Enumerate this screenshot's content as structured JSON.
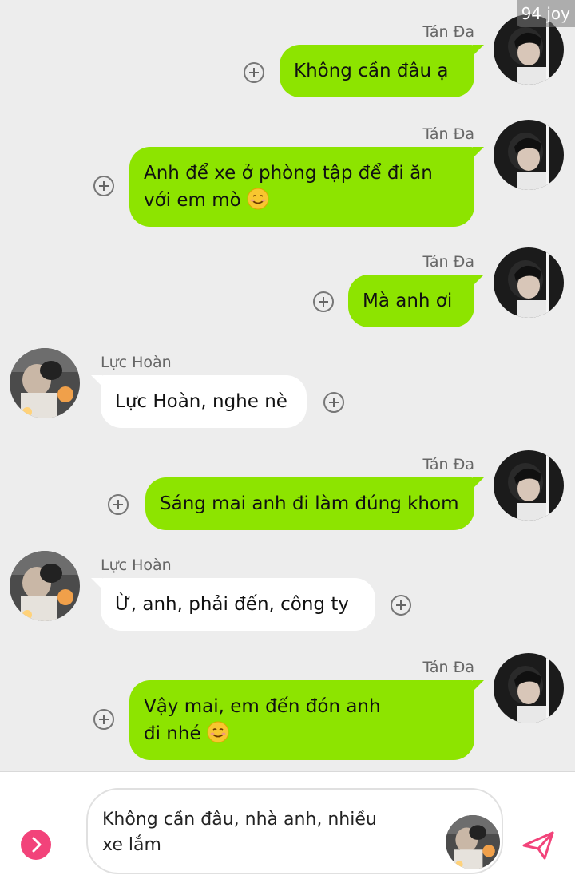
{
  "watermark": "94 joy",
  "messages": [
    {
      "side": "right",
      "sender": "Tán Đa",
      "lines": [
        "Không cần đâu ạ"
      ],
      "emoji": false
    },
    {
      "side": "right",
      "sender": "Tán Đa",
      "lines": [
        "Anh để xe ở phòng tập để đi ăn",
        "với em mò"
      ],
      "emoji": true
    },
    {
      "side": "right",
      "sender": "Tán Đa",
      "lines": [
        "Mà anh ơi"
      ],
      "emoji": false
    },
    {
      "side": "left",
      "sender": "Lực Hoàn",
      "lines": [
        "Lực Hoàn, nghe nè"
      ],
      "emoji": false
    },
    {
      "side": "right",
      "sender": "Tán Đa",
      "lines": [
        "Sáng mai anh đi làm đúng khom"
      ],
      "emoji": false
    },
    {
      "side": "left",
      "sender": "Lực Hoàn",
      "lines": [
        "Ừ, anh, phải đến, công ty"
      ],
      "emoji": false
    },
    {
      "side": "right",
      "sender": "Tán Đa",
      "lines": [
        "Vậy mai, em đến đón anh",
        "đi nhé"
      ],
      "emoji": true
    }
  ],
  "composer": {
    "text_line1": "Không cần đâu, nhà anh, nhiều",
    "text_line2": "xe lắm"
  },
  "colors": {
    "outgoing_bubble": "#8de400",
    "incoming_bubble": "#ffffff",
    "background": "#ededed",
    "accent": "#f2437a",
    "send_icon": "#f2437a"
  },
  "icons": {
    "add_reaction": "plus-circle-icon",
    "expand": "chevron-right-icon",
    "send": "paper-plane-icon",
    "emoji": "smiling-face-icon"
  }
}
